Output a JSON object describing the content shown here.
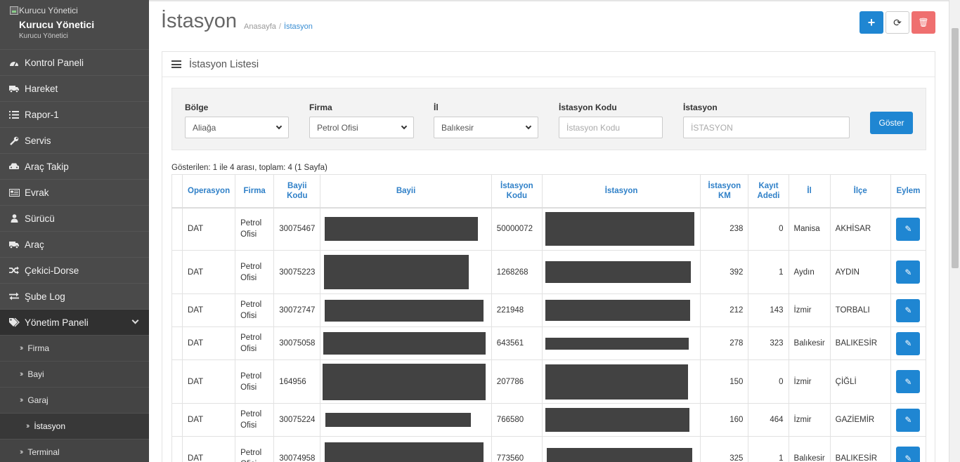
{
  "sidebar": {
    "profile": {
      "image_alt": "Kurucu Yönetici",
      "name": "Kurucu Yönetici",
      "role": "Kurucu Yönetici"
    },
    "items": [
      {
        "label": "Kontrol Paneli",
        "icon": "dashboard-icon"
      },
      {
        "label": "Hareket",
        "icon": "truck-icon"
      },
      {
        "label": "Rapor-1",
        "icon": "list-icon"
      },
      {
        "label": "Servis",
        "icon": "wrench-icon"
      },
      {
        "label": "Araç Takip",
        "icon": "car-icon"
      },
      {
        "label": "Evrak",
        "icon": "document-icon"
      },
      {
        "label": "Sürücü",
        "icon": "user-icon"
      },
      {
        "label": "Araç",
        "icon": "truck-icon"
      },
      {
        "label": "Çekici-Dorse",
        "icon": "shuffle-icon"
      },
      {
        "label": "Şube Log",
        "icon": "exchange-icon"
      },
      {
        "label": "Yönetim Paneli",
        "icon": "tags-icon"
      }
    ],
    "subitems": [
      {
        "label": "Firma"
      },
      {
        "label": "Bayi"
      },
      {
        "label": "Garaj"
      },
      {
        "label": "İstasyon"
      },
      {
        "label": "Terminal"
      }
    ]
  },
  "header": {
    "title": "İstasyon",
    "breadcrumb": {
      "home": "Anasayfa",
      "separator": "/",
      "current": "İstasyon"
    },
    "buttons": {
      "add": "+",
      "refresh": "⟳",
      "delete": "🗑"
    }
  },
  "panel": {
    "title": "İstasyon Listesi"
  },
  "filters": {
    "bolge": {
      "label": "Bölge",
      "value": "Aliağa"
    },
    "firma": {
      "label": "Firma",
      "value": "Petrol Ofisi"
    },
    "il": {
      "label": "İl",
      "value": "Balıkesir"
    },
    "istasyon_kodu": {
      "label": "İstasyon Kodu",
      "placeholder": "İstasyon Kodu"
    },
    "istasyon": {
      "label": "İstasyon",
      "placeholder": "İSTASYON"
    },
    "submit": "Göster"
  },
  "summary": "Gösterilen: 1 ile 4 arası, toplam: 4 (1 Sayfa)",
  "table": {
    "headers": [
      "",
      "Operasyon",
      "Firma",
      "Bayii Kodu",
      "Bayii",
      "İstasyon Kodu",
      "İstasyon",
      "İstasyon KM",
      "Kayıt Adedi",
      "İl",
      "İlçe",
      "Eylem"
    ],
    "rows": [
      {
        "operasyon": "DAT",
        "firma": "Petrol Ofisi",
        "bayii_kodu": "30075467",
        "istasyon_kodu": "50000072",
        "km": "238",
        "kayit": "0",
        "il": "Manisa",
        "ilce": "AKHİSAR"
      },
      {
        "operasyon": "DAT",
        "firma": "Petrol Ofisi",
        "bayii_kodu": "30075223",
        "istasyon_kodu": "1268268",
        "km": "392",
        "kayit": "1",
        "il": "Aydın",
        "ilce": "AYDIN"
      },
      {
        "operasyon": "DAT",
        "firma": "Petrol Ofisi",
        "bayii_kodu": "30072747",
        "istasyon_kodu": "221948",
        "km": "212",
        "kayit": "143",
        "il": "İzmir",
        "ilce": "TORBALI"
      },
      {
        "operasyon": "DAT",
        "firma": "Petrol Ofisi",
        "bayii_kodu": "30075058",
        "istasyon_kodu": "643561",
        "km": "278",
        "kayit": "323",
        "il": "Balıkesir",
        "ilce": "BALIKESİR"
      },
      {
        "operasyon": "DAT",
        "firma": "Petrol Ofisi",
        "bayii_kodu": "164956",
        "istasyon_kodu": "207786",
        "km": "150",
        "kayit": "0",
        "il": "İzmir",
        "ilce": "ÇİĞLİ"
      },
      {
        "operasyon": "DAT",
        "firma": "Petrol Ofisi",
        "bayii_kodu": "30075224",
        "istasyon_kodu": "766580",
        "km": "160",
        "kayit": "464",
        "il": "İzmir",
        "ilce": "GAZİEMİR"
      },
      {
        "operasyon": "DAT",
        "firma": "Petrol Ofisi",
        "bayii_kodu": "30074958",
        "istasyon_kodu": "773560",
        "km": "325",
        "kayit": "1",
        "il": "Balıkesir",
        "ilce": "BALIKESİR"
      }
    ]
  }
}
